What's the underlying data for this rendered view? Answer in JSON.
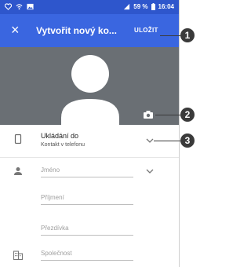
{
  "statusbar": {
    "battery": "59 %",
    "time": "16:04"
  },
  "appbar": {
    "close_glyph": "×",
    "title": "Vytvořit nový ko...",
    "save_label": "ULOŽIT"
  },
  "storage": {
    "label": "Ukládání do",
    "value": "Kontakt v telefonu"
  },
  "fields": {
    "first_name_placeholder": "Jméno",
    "last_name_placeholder": "Příjmení",
    "nickname_placeholder": "Přezdívka",
    "company_placeholder": "Společnost"
  },
  "callouts": [
    "1",
    "2",
    "3"
  ],
  "colors": {
    "statusbar": "#2e56cc",
    "appbar": "#3a66e0",
    "photo_bg": "#6a6f74"
  }
}
